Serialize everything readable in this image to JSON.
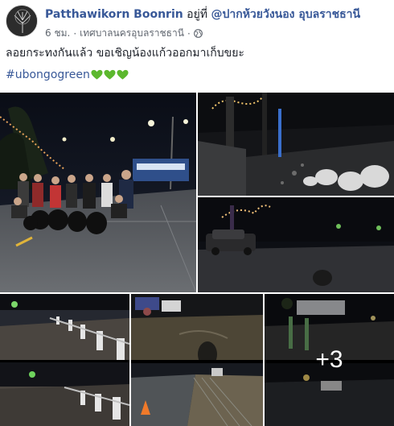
{
  "post": {
    "author": "Patthawikorn Boonrin",
    "at_text": "อยู่ที่",
    "place": "@ปากห้วยวังนอง อุบลราชธานี",
    "time": "6 ชม.",
    "dot": "·",
    "location": "เทศบาลนครอุบลราชธานี",
    "dot2": "·",
    "privacy_icon": "globe-icon",
    "text": "ลอยกระทงกันแล้ว ขอเชิญน้องแก้วออกมาเก็บขยะ",
    "hashtag": "#ubongogreen",
    "hearts": [
      "green-heart-icon",
      "green-heart-icon",
      "green-heart-icon"
    ]
  },
  "photos": {
    "count": 6,
    "more_label": "+3"
  },
  "colors": {
    "link": "#385898",
    "text": "#1d2129",
    "meta": "#616770",
    "heart": "#5cb82e"
  }
}
